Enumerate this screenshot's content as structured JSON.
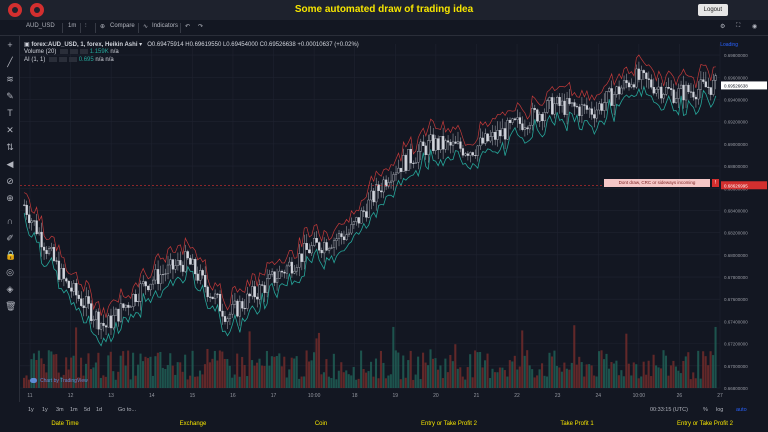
{
  "header": {
    "title": "Some automated draw of trading idea",
    "logout_label": "Logout"
  },
  "toolbar": {
    "symbol": "AUD_USD",
    "interval": "1m",
    "compare_label": "Compare",
    "indicators_label": "Indicators"
  },
  "legend": {
    "symbol_line": "forex:AUD_USD, 1, forex, Heikin Ashi",
    "o_label": "O",
    "o_value": "0.69475914",
    "h_label": "H",
    "h_value": "0.69619550",
    "l_label": "L",
    "l_value": "0.69454000",
    "c_label": "C",
    "c_value": "0.69526638",
    "change": "+0.00010637 (+0.02%)",
    "volume_label": "Volume (20)",
    "volume_value": "1.159K",
    "volume_na": "n/a",
    "ai_label": "AI (1, 1)",
    "ai_value": "0.695",
    "ai_na1": "n/a",
    "ai_na2": "n/a",
    "loading": "Loading"
  },
  "alert": {
    "text": "Dont draw, CRC or sideways incoming",
    "tag": "!",
    "price": "0.68626995"
  },
  "current_price": "0.69526638",
  "price_ticks": [
    "0.69800000",
    "0.69600000",
    "0.69400000",
    "0.69200000",
    "0.69000000",
    "0.68800000",
    "0.68600000",
    "0.68400000",
    "0.68200000",
    "0.68000000",
    "0.67800000",
    "0.67600000",
    "0.67400000",
    "0.67200000",
    "0.67000000",
    "0.66800000"
  ],
  "time_ticks": [
    "11",
    "12",
    "13",
    "14",
    "15",
    "16",
    "17",
    "10:00",
    "18",
    "19",
    "20",
    "21",
    "22",
    "23",
    "24",
    "10:00",
    "26",
    "27"
  ],
  "watermark": "Chart by TradingView",
  "timeframes": [
    "1y",
    "1y",
    "3m",
    "1m",
    "5d",
    "1d",
    "Go to..."
  ],
  "clock": "00:33:15 (UTC)",
  "scale_options": [
    "%",
    "log",
    "auto"
  ],
  "bottom_nav": [
    "Date Time",
    "Exchange",
    "Coin",
    "Entry or Take Profit 2",
    "Take Profit 1",
    "Entry or Take Profit 2"
  ],
  "colors": {
    "accent": "#f7e600",
    "up": "#26a69a",
    "down": "#ef5350",
    "alert": "#d32f2f"
  },
  "chart_data": {
    "type": "line",
    "series": [
      {
        "name": "forex:AUD_USD",
        "x": [
          "11",
          "12",
          "13",
          "14",
          "15",
          "16",
          "17",
          "10:00",
          "18",
          "19",
          "20",
          "21",
          "22",
          "23",
          "24",
          "10:00",
          "26",
          "27"
        ],
        "values": [
          0.6845,
          0.6775,
          0.6735,
          0.6775,
          0.6795,
          0.6745,
          0.6775,
          0.6805,
          0.682,
          0.6875,
          0.69,
          0.6895,
          0.6915,
          0.6935,
          0.693,
          0.696,
          0.6945,
          0.6953
        ]
      }
    ],
    "ylim": [
      0.668,
      0.699
    ]
  }
}
